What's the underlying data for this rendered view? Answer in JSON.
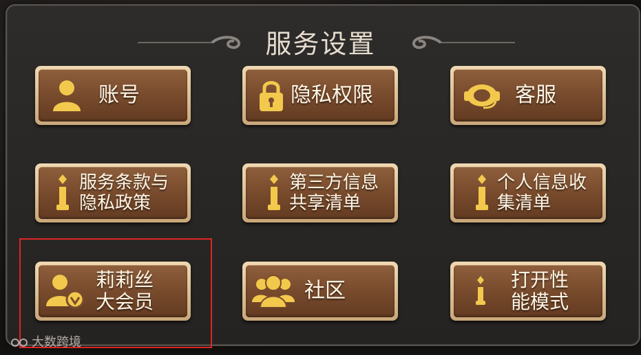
{
  "title": "服务设置",
  "buttons": [
    {
      "label": "账号",
      "icon": "user-icon"
    },
    {
      "label": "隐私权限",
      "icon": "lock-icon"
    },
    {
      "label": "客服",
      "icon": "headset-icon"
    },
    {
      "label": "服务条款与\n隐私政策",
      "icon": "info-icon"
    },
    {
      "label": "第三方信息\n共享清单",
      "icon": "info-icon"
    },
    {
      "label": "个人信息收\n集清单",
      "icon": "info-icon"
    },
    {
      "label": "莉莉丝\n大会员",
      "icon": "vip-user-icon"
    },
    {
      "label": "社区",
      "icon": "community-icon"
    },
    {
      "label": "打开性\n能模式",
      "icon": "info-icon"
    }
  ],
  "watermark": "大数跨境",
  "colors": {
    "highlight": "#e02424",
    "button_face": "#7a4c2e",
    "button_border": "#e3c79c",
    "icon_gold": "#f2c94c"
  }
}
